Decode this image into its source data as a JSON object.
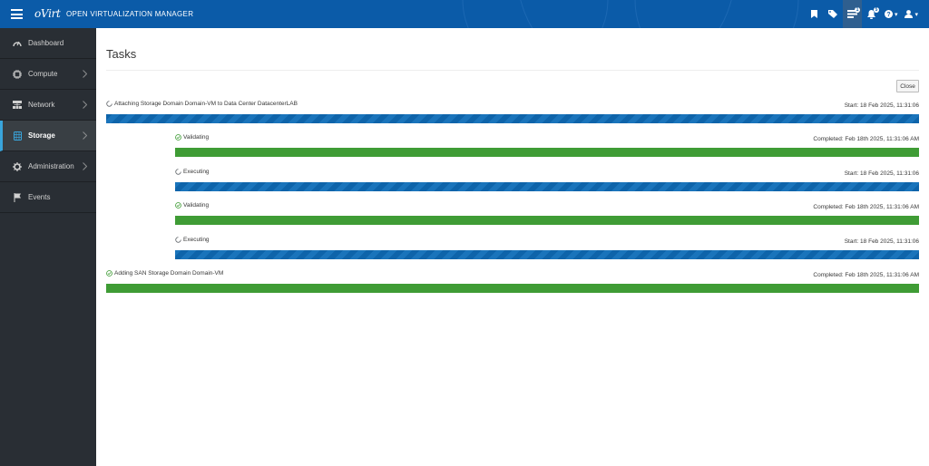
{
  "header": {
    "logo": "oVirt",
    "title": "OPEN VIRTUALIZATION MANAGER",
    "tasks_badge": "1",
    "alerts_badge": "5"
  },
  "sidebar": {
    "items": [
      {
        "label": "Dashboard",
        "icon": "dashboard-icon",
        "expandable": false,
        "active": false
      },
      {
        "label": "Compute",
        "icon": "cpu-icon",
        "expandable": true,
        "active": false
      },
      {
        "label": "Network",
        "icon": "network-icon",
        "expandable": true,
        "active": false
      },
      {
        "label": "Storage",
        "icon": "database-icon",
        "expandable": true,
        "active": true
      },
      {
        "label": "Administration",
        "icon": "gear-icon",
        "expandable": true,
        "active": false
      },
      {
        "label": "Events",
        "icon": "flag-icon",
        "expandable": false,
        "active": false
      }
    ]
  },
  "main": {
    "title": "Tasks",
    "close_label": "Close",
    "tasks": [
      {
        "name": "Attaching Storage Domain Domain-VM to Data Center DatacenterLAB",
        "time": "Start: 18 Feb 2025, 11:31:06",
        "status": "running",
        "level": 0
      },
      {
        "name": "Validating",
        "time": "Completed: Feb 18th 2025, 11:31:06 AM",
        "status": "done",
        "level": 1
      },
      {
        "name": "Executing",
        "time": "Start: 18 Feb 2025, 11:31:06",
        "status": "running",
        "level": 1
      },
      {
        "name": "Validating",
        "time": "Completed: Feb 18th 2025, 11:31:06 AM",
        "status": "done",
        "level": 1
      },
      {
        "name": "Executing",
        "time": "Start: 18 Feb 2025, 11:31:06",
        "status": "running",
        "level": 1
      },
      {
        "name": "Adding SAN Storage Domain Domain-VM",
        "time": "Completed: Feb 18th 2025, 11:31:06 AM",
        "status": "done",
        "level": 0
      }
    ]
  },
  "colors": {
    "header_bg": "#0b5ba8",
    "sidebar_bg": "#292e34",
    "running_bar": "#0e64aa",
    "done_bar": "#3f9c35",
    "active_accent": "#39a5dc"
  }
}
